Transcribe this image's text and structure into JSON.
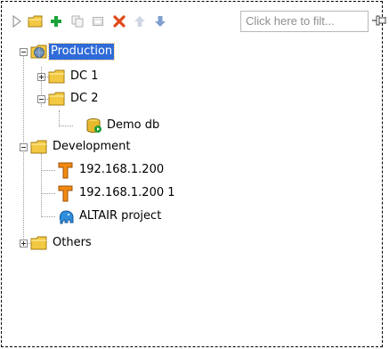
{
  "toolbar": {
    "filter_placeholder": "Click here to filt...",
    "buttons": [
      {
        "name": "expand-arrow-icon"
      },
      {
        "name": "new-folder-icon"
      },
      {
        "name": "add-icon"
      },
      {
        "name": "copy-icon"
      },
      {
        "name": "window-icon"
      },
      {
        "name": "delete-icon"
      },
      {
        "name": "move-up-icon"
      },
      {
        "name": "move-down-icon"
      }
    ],
    "pin_icon": "pin-icon"
  },
  "tree": {
    "production": {
      "label": "Production",
      "selected": true
    },
    "dc1": {
      "label": "DC 1"
    },
    "dc2": {
      "label": "DC 2"
    },
    "demo_db": {
      "label": "Demo db"
    },
    "development": {
      "label": "Development"
    },
    "server1": {
      "label": "192.168.1.200"
    },
    "server2": {
      "label": "192.168.1.200 1"
    },
    "altair": {
      "label": "ALTAIR project"
    },
    "others": {
      "label": "Others"
    }
  },
  "colors": {
    "selection": "#2f6ad8",
    "folder": "#f3c842",
    "add": "#1aa33a",
    "delete": "#e04a1a",
    "arrows": "#7f9fd0"
  }
}
